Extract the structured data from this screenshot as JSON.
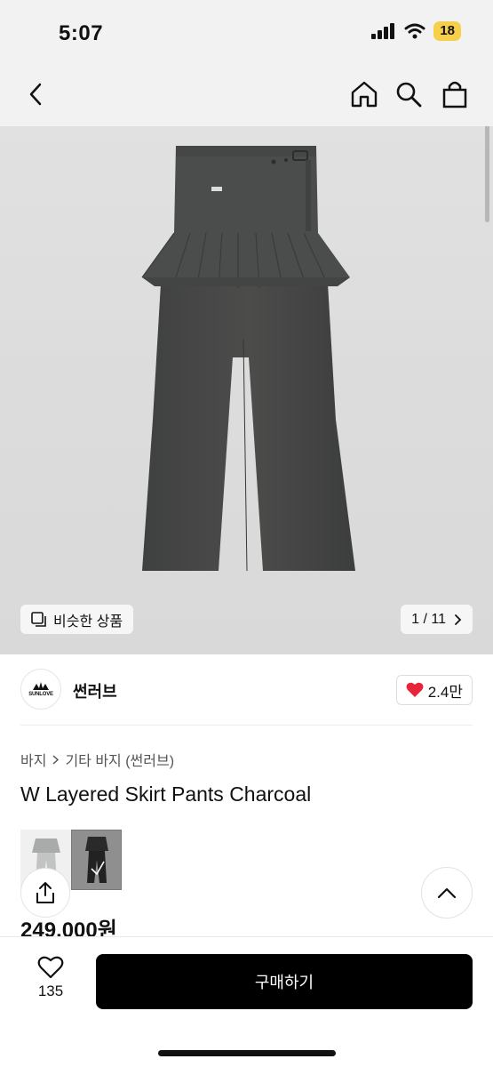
{
  "status": {
    "time": "5:07",
    "battery": "18"
  },
  "nav": {
    "back_icon": "chevron-left-icon",
    "home_icon": "home-icon",
    "search_icon": "search-icon",
    "bag_icon": "shopping-bag-icon"
  },
  "gallery": {
    "similar_label": "비슷한 상품",
    "pager": "1 / 11"
  },
  "brand": {
    "logo_text": "SUNLOVE",
    "name": "썬러브",
    "likes": "2.4만"
  },
  "breadcrumb": {
    "level1": "바지",
    "level2": "기타 바지 (썬러브)"
  },
  "product": {
    "title": "W Layered Skirt Pants Charcoal",
    "price": "249,000원"
  },
  "bottom": {
    "wish_count": "135",
    "buy_label": "구매하기"
  },
  "colors": {
    "accent": "#000000",
    "heart": "#e8243a",
    "garment": "#4a4b4b"
  }
}
